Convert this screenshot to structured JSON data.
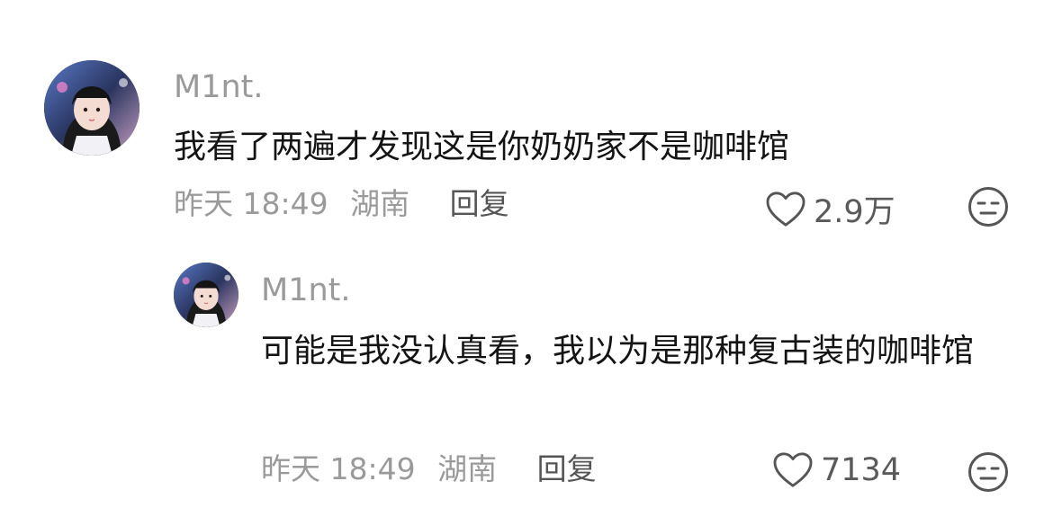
{
  "comments": [
    {
      "username": "M1nt.",
      "text": "我看了两遍才发现这是你奶奶家不是咖啡馆",
      "time": "昨天 18:49",
      "location": "湖南",
      "reply_label": "回复",
      "likes": "2.9万",
      "avatar_icon": "avatar",
      "like_icon": "heart-outline-icon",
      "dislike_icon": "unamused-face-icon"
    },
    {
      "username": "M1nt.",
      "text": "可能是我没认真看，我以为是那种复古装的咖啡馆",
      "time": "昨天 18:49",
      "location": "湖南",
      "reply_label": "回复",
      "likes": "7134",
      "avatar_icon": "avatar",
      "like_icon": "heart-outline-icon",
      "dislike_icon": "unamused-face-icon"
    }
  ],
  "colors": {
    "text": "#141414",
    "secondary": "#9a9a9a",
    "reply": "#555555",
    "icon": "#555555"
  }
}
